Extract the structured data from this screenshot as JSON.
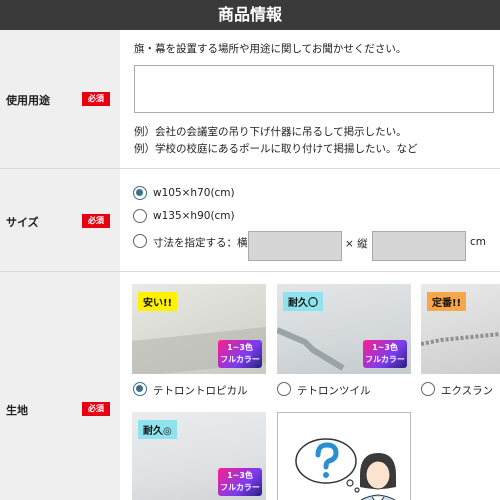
{
  "header": {
    "title": "商品情報"
  },
  "usage": {
    "label": "使用用途",
    "required": "必須",
    "instruction": "旗・幕を設置する場所や用途に関してお聞かせください。",
    "textarea_value": "",
    "example1": "例）会社の会議室の吊り下げ什器に吊るして掲示したい。",
    "example2": "例）学校の校庭にあるポールに取り付けて掲揚したい。など"
  },
  "size": {
    "label": "サイズ",
    "required": "必須",
    "options": [
      {
        "label": "w105×h70(cm)",
        "checked": true
      },
      {
        "label": "w135×h90(cm)",
        "checked": false
      },
      {
        "label": "寸法を指定する：横",
        "checked": false
      }
    ],
    "width_value": "",
    "times_label": "× 縦",
    "height_value": "",
    "unit": "cm"
  },
  "fabric": {
    "label": "生地",
    "required": "必須",
    "options": [
      {
        "tag": "安い!!",
        "badge_line1": "1~3色",
        "badge_line2": "フルカラー",
        "label": "テトロントロピカル",
        "checked": true
      },
      {
        "tag": "耐久〇",
        "badge_line1": "1~3色",
        "badge_line2": "フルカラー",
        "label": "テトロンツイル",
        "checked": false
      },
      {
        "tag": "定番!!",
        "badge_line1": "",
        "badge_line2": "",
        "label": "エクスラン",
        "checked": false
      },
      {
        "tag": "耐久◎",
        "badge_line1": "1~3色",
        "badge_line2": "フルカラー",
        "label": "",
        "checked": false
      }
    ]
  },
  "colors": {
    "header_bg": "#3a3a3a",
    "required_bg": "#e60012",
    "radio_checked": "#3b6e8f"
  }
}
